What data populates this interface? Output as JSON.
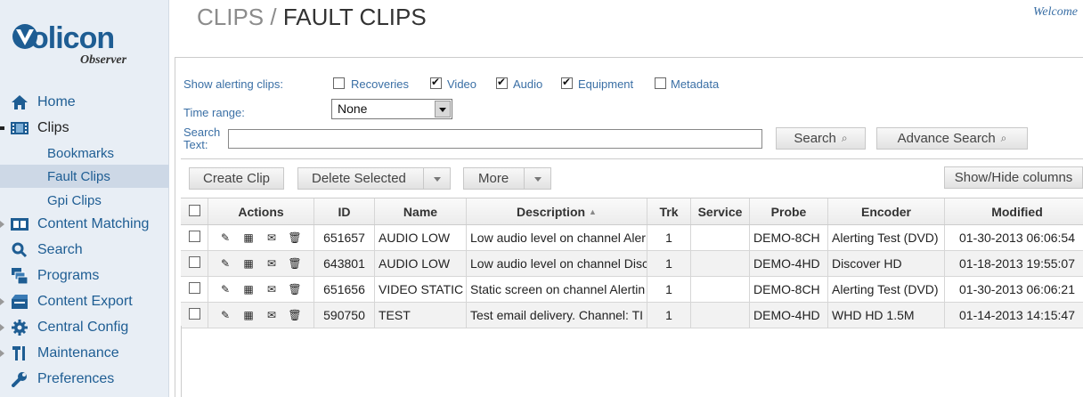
{
  "brand": {
    "name_prefix": "V",
    "name_rest": "olicon",
    "product": "Observer"
  },
  "header": {
    "section": "CLIPS",
    "separator": " / ",
    "current": "FAULT CLIPS",
    "welcome": "Welcome"
  },
  "sidebar": {
    "items": [
      {
        "label": "Home",
        "icon": "home-icon"
      },
      {
        "label": "Clips",
        "icon": "film-icon"
      },
      {
        "label": "Content Matching",
        "icon": "content-matching-icon"
      },
      {
        "label": "Search",
        "icon": "search-icon"
      },
      {
        "label": "Programs",
        "icon": "programs-icon"
      },
      {
        "label": "Content Export",
        "icon": "export-icon"
      },
      {
        "label": "Central Config",
        "icon": "gear-icon"
      },
      {
        "label": "Maintenance",
        "icon": "tools-icon"
      },
      {
        "label": "Preferences",
        "icon": "wrench-icon"
      }
    ],
    "clips_sub": [
      {
        "label": "Bookmarks"
      },
      {
        "label": "Fault Clips",
        "active": true
      },
      {
        "label": "Gpi Clips"
      }
    ]
  },
  "filters": {
    "show_label": "Show alerting clips:",
    "options": [
      {
        "label": "Recoveries",
        "checked": false
      },
      {
        "label": "Video",
        "checked": true
      },
      {
        "label": "Audio",
        "checked": true
      },
      {
        "label": "Equipment",
        "checked": true
      },
      {
        "label": "Metadata",
        "checked": false
      }
    ],
    "time_range_label": "Time range:",
    "time_range_value": "None",
    "search_label_1": "Search",
    "search_label_2": "Text:",
    "search_value": "",
    "search_button": "Search",
    "advance_search_button": "Advance Search"
  },
  "toolbar": {
    "create_clip": "Create Clip",
    "delete_selected": "Delete Selected",
    "more": "More",
    "show_hide_columns": "Show/Hide columns"
  },
  "table": {
    "columns": [
      "Actions",
      "ID",
      "Name",
      "Description",
      "Trk",
      "Service",
      "Probe",
      "Encoder",
      "Modified"
    ],
    "rows": [
      {
        "id": "651657",
        "name": "AUDIO LOW",
        "description": "Low audio level on channel Aler",
        "trk": "1",
        "service": "",
        "probe": "DEMO-8CH",
        "encoder": "Alerting Test (DVD)",
        "modified": "01-30-2013 06:06:54"
      },
      {
        "id": "643801",
        "name": "AUDIO LOW",
        "description": "Low audio level on channel Disc",
        "trk": "1",
        "service": "",
        "probe": "DEMO-4HD",
        "encoder": "Discover HD",
        "modified": "01-18-2013 19:55:07"
      },
      {
        "id": "651656",
        "name": "VIDEO STATIC",
        "description": "Static screen on channel Alertin",
        "trk": "1",
        "service": "",
        "probe": "DEMO-8CH",
        "encoder": "Alerting Test (DVD)",
        "modified": "01-30-2013 06:06:21"
      },
      {
        "id": "590750",
        "name": "TEST",
        "description": "Test email delivery. Channel: TI",
        "trk": "1",
        "service": "",
        "probe": "DEMO-4HD",
        "encoder": "WHD HD 1.5M",
        "modified": "01-14-2013 14:15:47"
      }
    ],
    "action_icons": [
      "edit-icon",
      "film-icon",
      "email-icon",
      "trash-icon"
    ]
  },
  "colors": {
    "accent": "#1e5d93",
    "link": "#3a6fa5",
    "sidebar_bg": "#e8eef5",
    "active_bg": "#cdd8e6"
  }
}
